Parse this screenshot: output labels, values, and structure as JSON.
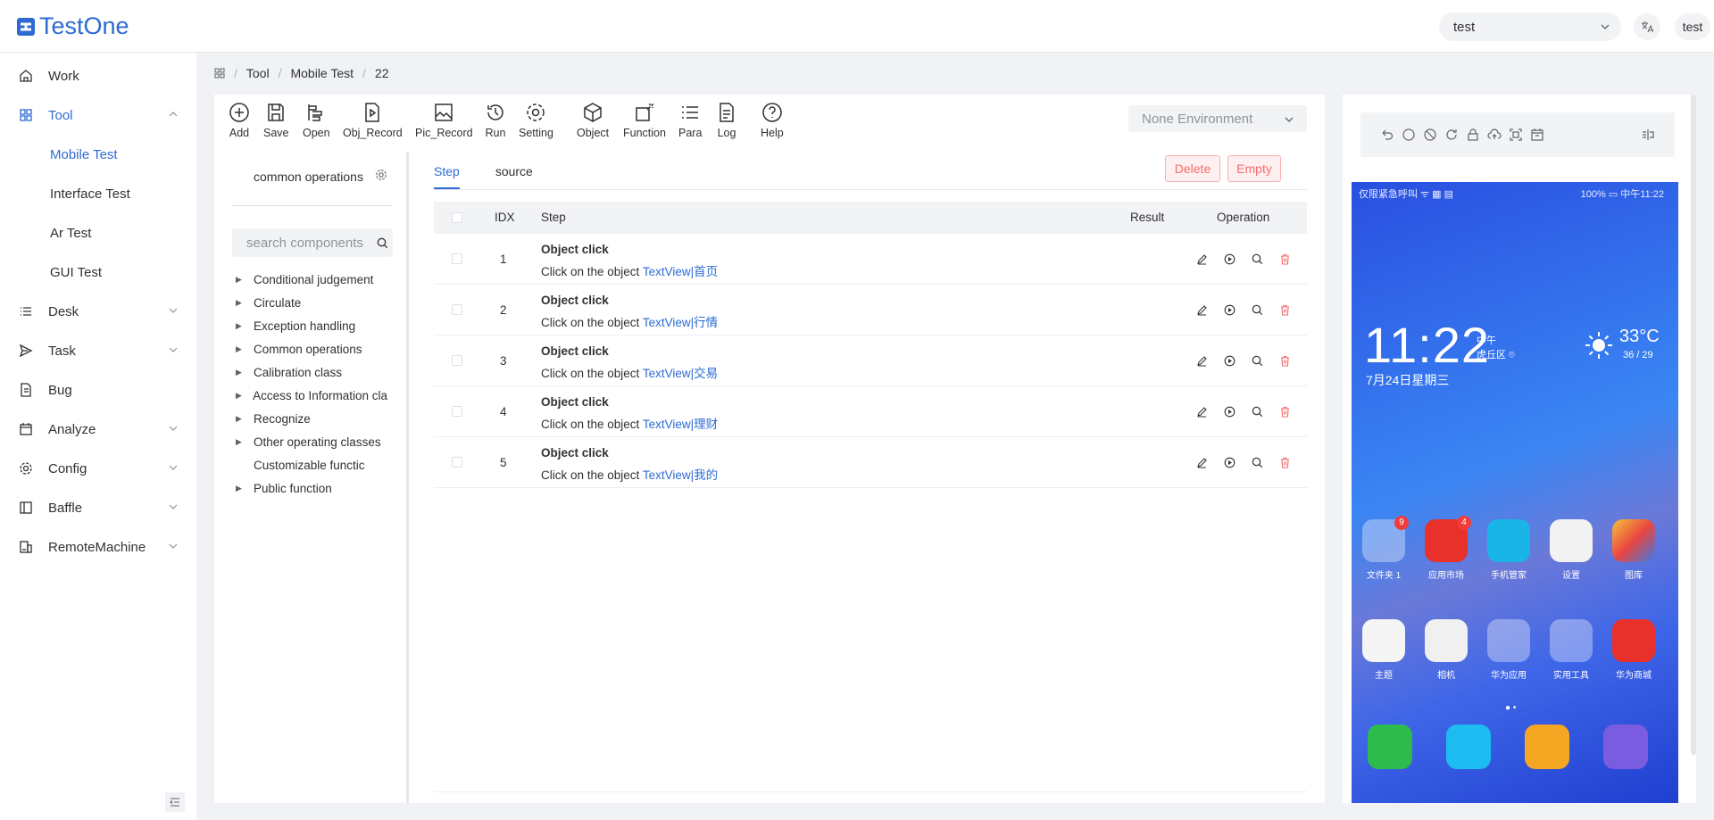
{
  "app": {
    "logo_text": "TestOne",
    "project": "test",
    "user": "test"
  },
  "sidebar": {
    "items": [
      {
        "label": "Work",
        "icon": "home-icon"
      },
      {
        "label": "Tool",
        "icon": "grid-icon",
        "active": true,
        "expanded": true,
        "children": [
          "Mobile Test",
          "Interface Test",
          "Ar Test",
          "GUI Test"
        ]
      },
      {
        "label": "Desk",
        "icon": "list-icon"
      },
      {
        "label": "Task",
        "icon": "send-icon"
      },
      {
        "label": "Bug",
        "icon": "document-icon"
      },
      {
        "label": "Analyze",
        "icon": "calendar-icon"
      },
      {
        "label": "Config",
        "icon": "gear-icon"
      },
      {
        "label": "Baffle",
        "icon": "panel-icon"
      },
      {
        "label": "RemoteMachine",
        "icon": "machine-icon"
      }
    ]
  },
  "breadcrumb": [
    "Tool",
    "Mobile Test",
    "22"
  ],
  "toolbar": {
    "items": [
      "Add",
      "Save",
      "Open",
      "Obj_Record",
      "Pic_Record",
      "Run",
      "Setting",
      "Object",
      "Function",
      "Para",
      "Log",
      "Help"
    ],
    "environment": "None Environment"
  },
  "components": {
    "title": "common operations",
    "search_placeholder": "search components",
    "tree": [
      "Conditional judgement",
      "Circulate",
      "Exception handling",
      "Common operations",
      "Calibration class",
      "Access to Information cla",
      "Recognize",
      "Other operating classes",
      "Customizable functic",
      "Public function"
    ]
  },
  "tabs": [
    "Step",
    "source"
  ],
  "actions": {
    "delete": "Delete",
    "empty": "Empty"
  },
  "table": {
    "headers": {
      "idx": "IDX",
      "step": "Step",
      "result": "Result",
      "operation": "Operation"
    },
    "rows": [
      {
        "idx": "1",
        "title": "Object click",
        "desc": "Click on the object ",
        "obj": "TextView|首页"
      },
      {
        "idx": "2",
        "title": "Object click",
        "desc": "Click on the object ",
        "obj": "TextView|行情"
      },
      {
        "idx": "3",
        "title": "Object click",
        "desc": "Click on the object ",
        "obj": "TextView|交易"
      },
      {
        "idx": "4",
        "title": "Object click",
        "desc": "Click on the object ",
        "obj": "TextView|理财"
      },
      {
        "idx": "5",
        "title": "Object click",
        "desc": "Click on the object ",
        "obj": "TextView|我的"
      }
    ]
  },
  "phone": {
    "status_left": "仅限紧急呼叫 ᯤ ▦ ▤",
    "status_right": "100% ▭ 中午11:22",
    "clock": "11:22",
    "ampm": "中午",
    "location": "虎丘区",
    "date": "7月24日星期三",
    "temp": "33°C",
    "temp_range": "36 / 29",
    "apps_row1": [
      {
        "label": "文件夹 1",
        "badge": "9"
      },
      {
        "label": "应用市场",
        "badge": "4"
      },
      {
        "label": "手机管家"
      },
      {
        "label": "设置"
      },
      {
        "label": "图库"
      }
    ],
    "apps_row2": [
      {
        "label": "主题"
      },
      {
        "label": "相机"
      },
      {
        "label": "华为应用"
      },
      {
        "label": "实用工具"
      },
      {
        "label": "华为商城"
      }
    ]
  },
  "colors": {
    "accent": "#2d6bd3",
    "danger": "#f56c6c"
  }
}
